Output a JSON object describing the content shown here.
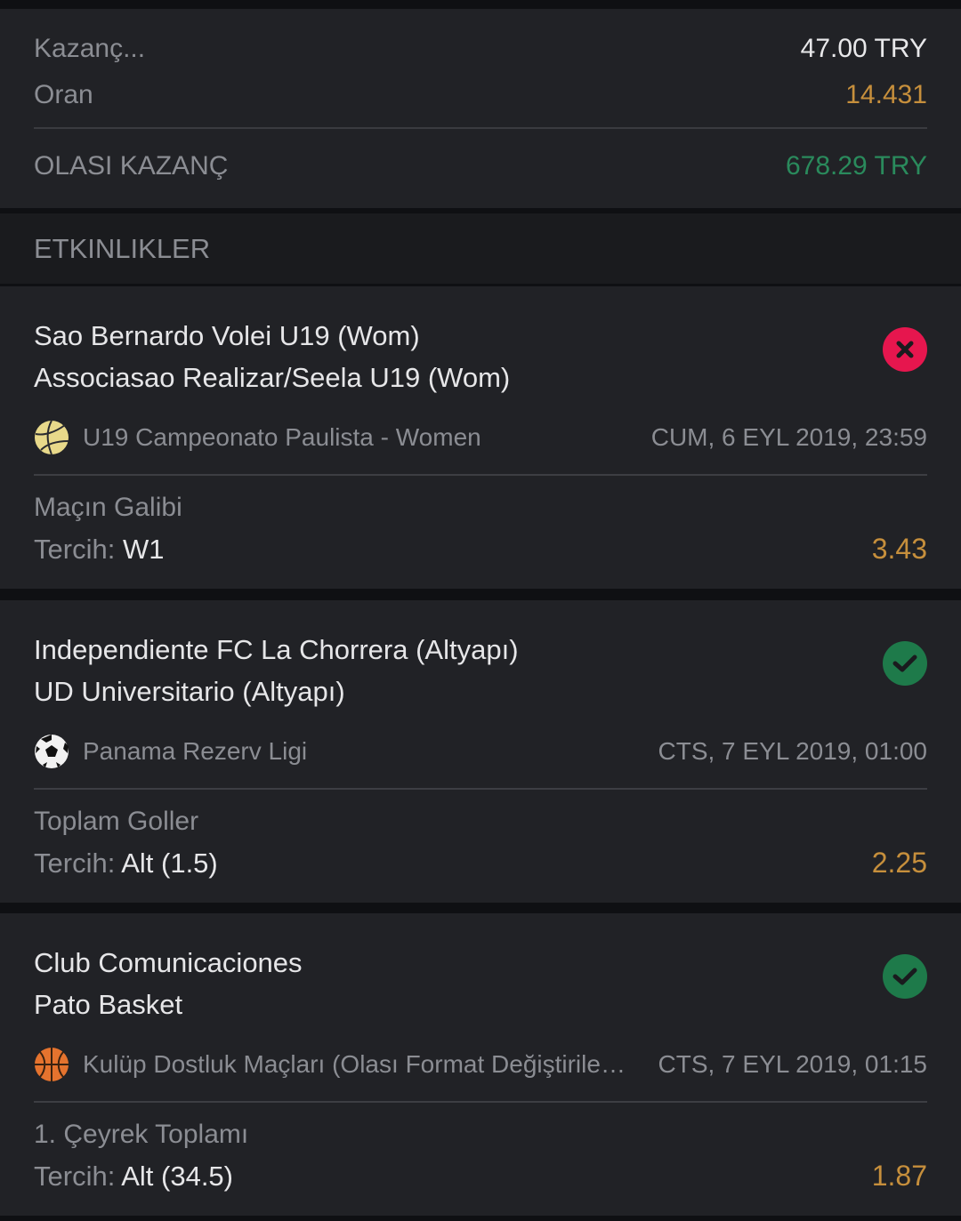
{
  "summary": {
    "stake_label": "Kazanç...",
    "stake_value": "47.00 TRY",
    "odds_label": "Oran",
    "odds_value": "14.431",
    "potential_label": "OLASI KAZANÇ",
    "potential_value": "678.29 TRY"
  },
  "section": {
    "title": "ETKINLIKLER"
  },
  "events": [
    {
      "team1": "Sao Bernardo Volei U19 (Wom)",
      "team2": "Associasao Realizar/Seela U19 (Wom)",
      "status": "lost",
      "sport_icon": "volleyball-icon",
      "league": "U19 Campeonato Paulista - Women",
      "date": "CUM, 6 EYL 2019, 23:59",
      "market": "Maçın Galibi",
      "pick_label": "Tercih:",
      "pick_value": "W1",
      "odds": "3.43"
    },
    {
      "team1": "Independiente FC La Chorrera (Altyapı)",
      "team2": "UD Universitario (Altyapı)",
      "status": "won",
      "sport_icon": "soccer-ball-icon",
      "league": "Panama Rezerv Ligi",
      "date": "CTS, 7 EYL 2019, 01:00",
      "market": "Toplam Goller",
      "pick_label": "Tercih:",
      "pick_value": "Alt (1.5)",
      "odds": "2.25"
    },
    {
      "team1": "Club Comunicaciones",
      "team2": "Pato Basket",
      "status": "won",
      "sport_icon": "basketball-icon",
      "league": "Kulüp Dostluk Maçları (Olası Format Değiştirilebilir)",
      "date": "CTS, 7 EYL 2019, 01:15",
      "market": "1. Çeyrek Toplamı",
      "pick_label": "Tercih:",
      "pick_value": "Alt (34.5)",
      "odds": "1.87"
    }
  ],
  "colors": {
    "odds": "#c68f3c",
    "win_green": "#2a8a5c",
    "lost_red": "#e6164e"
  }
}
